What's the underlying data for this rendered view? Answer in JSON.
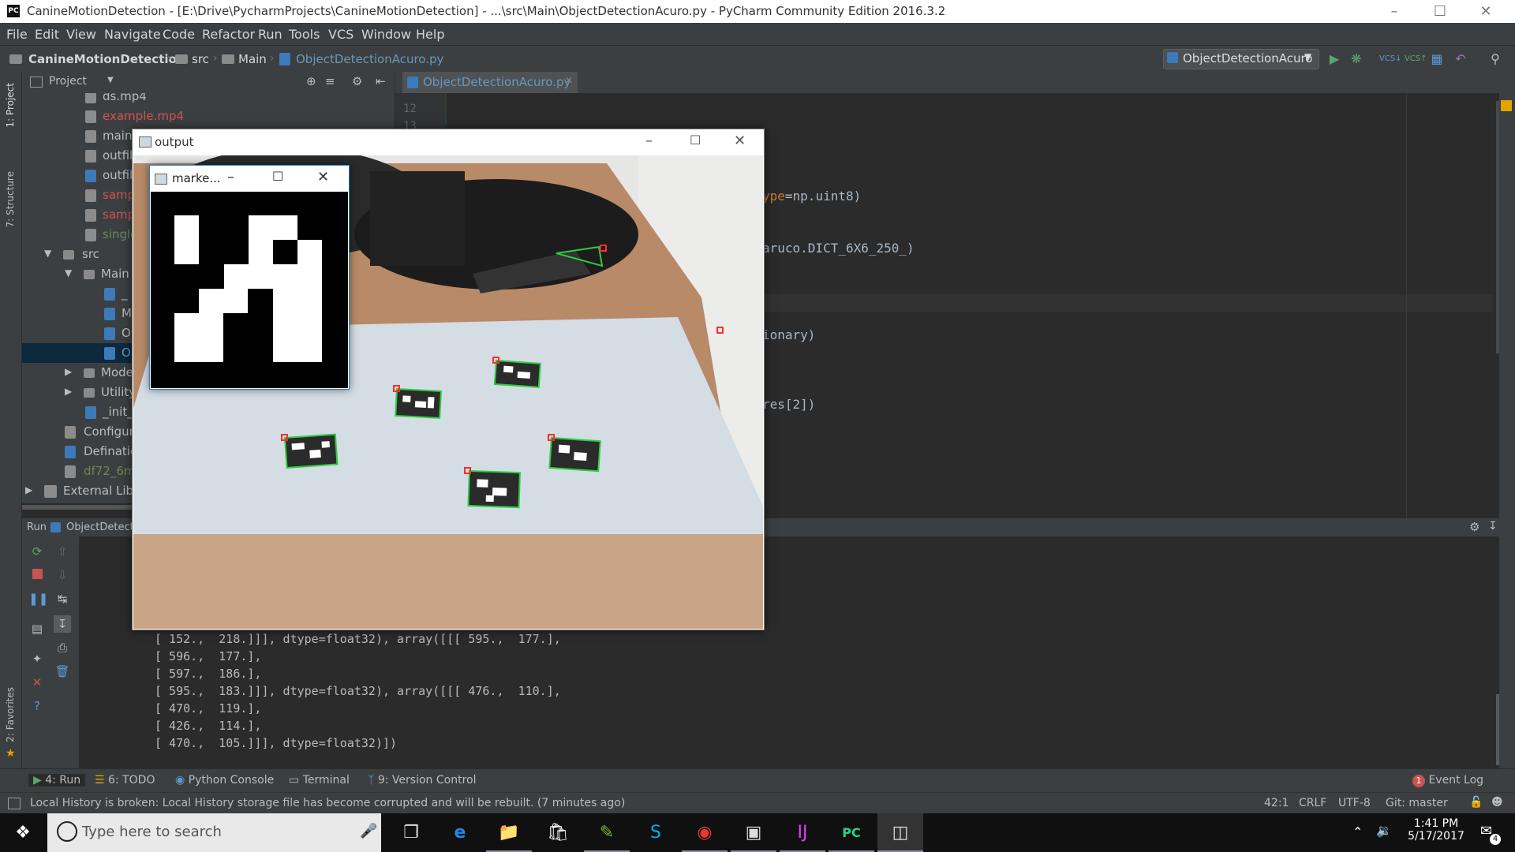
{
  "window_title": "CanineMotionDetection - [E:\\Drive\\PycharmProjects\\CanineMotionDetection] - ...\\src\\Main\\ObjectDetectionAcuro.py - PyCharm Community Edition 2016.3.2",
  "menu": [
    "File",
    "Edit",
    "View",
    "Navigate",
    "Code",
    "Refactor",
    "Run",
    "Tools",
    "VCS",
    "Window",
    "Help"
  ],
  "breadcrumb": {
    "project": "CanineMotionDetection",
    "folder1": "src",
    "folder2": "Main",
    "file": "ObjectDetectionAcuro.py"
  },
  "run_config": "ObjectDetectionAcuro",
  "side_tabs": {
    "project": "1: Project",
    "structure": "7: Structure",
    "favorites": "2: Favorites"
  },
  "project_panel": {
    "header": "Project",
    "rows": [
      {
        "text": "ds.mp4",
        "color": "#bbbbbb"
      },
      {
        "text": "example.mp4",
        "color": "#d25252"
      },
      {
        "text": "main_",
        "color": "#bbbbbb"
      },
      {
        "text": "outfil",
        "color": "#bbbbbb"
      },
      {
        "text": "outfil",
        "color": "#bbbbbb"
      },
      {
        "text": "samp",
        "color": "#d25252"
      },
      {
        "text": "samp",
        "color": "#d25252"
      },
      {
        "text": "single",
        "color": "#6a8759"
      },
      {
        "text": "src",
        "color": "#bbbbbb"
      },
      {
        "text": "Main",
        "color": "#bbbbbb"
      },
      {
        "text": "_",
        "color": "#bbbbbb"
      },
      {
        "text": "M",
        "color": "#bbbbbb"
      },
      {
        "text": "O",
        "color": "#bbbbbb"
      },
      {
        "text": "O",
        "color": "#6897bb"
      },
      {
        "text": "Mode",
        "color": "#bbbbbb"
      },
      {
        "text": "Utility",
        "color": "#bbbbbb"
      },
      {
        "text": "_init_",
        "color": "#bbbbbb"
      },
      {
        "text": "Configura",
        "color": "#bbbbbb"
      },
      {
        "text": "Definatio",
        "color": "#bbbbbb"
      },
      {
        "text": "df72_6mr",
        "color": "#6a8759"
      },
      {
        "text": "External Libra",
        "color": "#bbbbbb"
      }
    ]
  },
  "editor": {
    "tab": "ObjectDetectionAcuro.py",
    "line_numbers": [
      "12",
      "13"
    ],
    "code_fragments": [
      {
        "pre": "",
        "kw": "ype",
        "post": "=np.uint8)"
      },
      {
        "pre": "aruco.DICT_6X6_250_)",
        "kw": "",
        "post": ""
      },
      {
        "pre": "ionary)",
        "kw": "",
        "post": ""
      },
      {
        "pre": "res[2])",
        "kw": "",
        "post": ""
      }
    ]
  },
  "output_window": {
    "title": "output"
  },
  "marker_window": {
    "title": "marke..."
  },
  "run_panel": {
    "label": "Run",
    "config": "ObjectDetectio"
  },
  "console_lines": [
    "[ 152.,  218.]]], dtype=float32), array([[[ 595.,  177.],",
    "[ 596.,  177.],",
    "[ 597.,  186.],",
    "[ 595.,  183.]]], dtype=float32), array([[[ 476.,  110.],",
    "[ 470.,  119.],",
    "[ 426.,  114.],",
    "[ 470.,  105.]]], dtype=float32)])"
  ],
  "bottom_tabs": {
    "run": "4: Run",
    "todo": "6: TODO",
    "python_console": "Python Console",
    "terminal": "Terminal",
    "vcs": "9: Version Control",
    "event_log": "Event Log",
    "event_count": "1"
  },
  "status": {
    "message": "Local History is broken: Local History storage file has become corrupted and will be rebuilt. (7 minutes ago)",
    "position": "42:1",
    "line_sep": "CRLF",
    "encoding": "UTF-8",
    "git": "Git: master"
  },
  "taskbar": {
    "search_placeholder": "Type here to search",
    "time": "1:41 PM",
    "date": "5/17/2017",
    "notif_count": "4"
  },
  "colors": {
    "accent": "#1883d7",
    "ide_bg": "#2b2b2b",
    "panel_bg": "#3c3f41",
    "error_red": "#d25252",
    "marker_green": "#2ecc40"
  }
}
